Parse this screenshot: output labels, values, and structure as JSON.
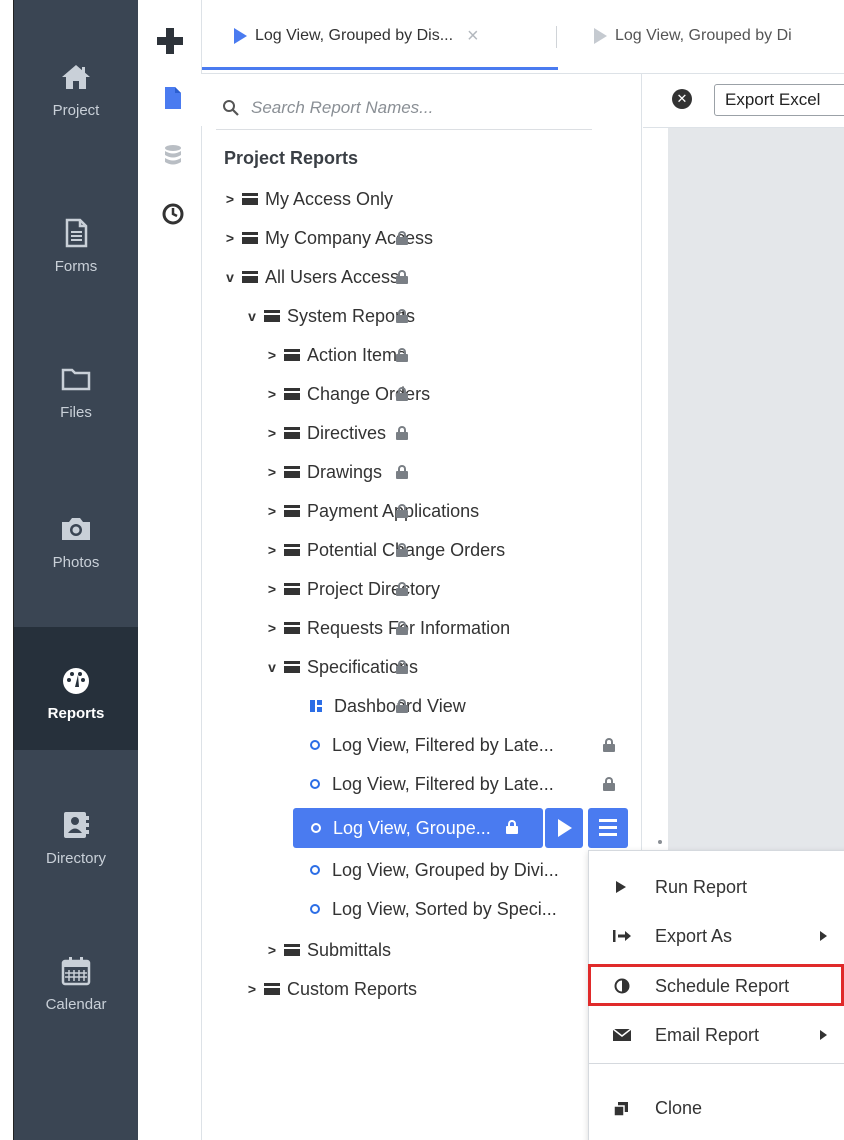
{
  "rail": {
    "items": [
      {
        "label": "Project",
        "icon": "home-icon"
      },
      {
        "label": "Forms",
        "icon": "document-icon"
      },
      {
        "label": "Files",
        "icon": "folder-icon"
      },
      {
        "label": "Photos",
        "icon": "camera-icon"
      },
      {
        "label": "Reports",
        "icon": "dashboard-gauge-icon",
        "active": true
      },
      {
        "label": "Directory",
        "icon": "contact-card-icon"
      },
      {
        "label": "Calendar",
        "icon": "calendar-icon"
      }
    ]
  },
  "side_icons": [
    "report-file-icon",
    "database-icon",
    "clock-icon"
  ],
  "tabs": [
    {
      "label": "Log View, Grouped by Dis...",
      "active": true
    },
    {
      "label": "Log View, Grouped by Di",
      "active": false
    }
  ],
  "search": {
    "placeholder": "Search Report Names..."
  },
  "tree": {
    "heading": "Project Reports",
    "nodes": [
      {
        "label": "My Access Only"
      },
      {
        "label": "My Company Access"
      },
      {
        "label": "All Users Access"
      },
      {
        "label": "System Reports"
      },
      {
        "label": "Action Items"
      },
      {
        "label": "Change Orders"
      },
      {
        "label": "Directives"
      },
      {
        "label": "Drawings"
      },
      {
        "label": "Payment Applications"
      },
      {
        "label": "Potential Change Orders"
      },
      {
        "label": "Project Directory"
      },
      {
        "label": "Requests For Information"
      },
      {
        "label": "Specifications"
      },
      {
        "label": "Dashboard View"
      },
      {
        "label": "Log View, Filtered by Late..."
      },
      {
        "label": "Log View, Filtered by Late..."
      },
      {
        "label": "Log View, Groupe..."
      },
      {
        "label": "Log View, Grouped by Divi..."
      },
      {
        "label": "Log View, Sorted by Speci..."
      },
      {
        "label": "Submittals"
      },
      {
        "label": "Custom Reports"
      }
    ]
  },
  "toolbar": {
    "export_label": "Export Excel"
  },
  "context_menu": {
    "items": [
      {
        "label": "Run Report"
      },
      {
        "label": "Export As"
      },
      {
        "label": "Schedule Report"
      },
      {
        "label": "Email Report"
      },
      {
        "label": "Clone"
      }
    ]
  },
  "colors": {
    "accent": "#4a7bf0",
    "rail_bg": "#3a4553",
    "rail_active_bg": "#26303b",
    "highlight_border": "#e02a2a"
  }
}
